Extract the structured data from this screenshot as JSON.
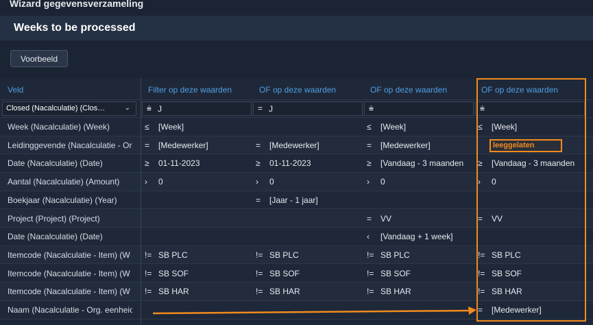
{
  "window": {
    "title": "Wizard gegevensverzameling"
  },
  "header": {
    "title": "Weeks to be processed"
  },
  "toolbar": {
    "preview_label": "Voorbeeld"
  },
  "columns": {
    "field": "Veld",
    "c1": "Filter op deze waarden",
    "c2": "OF op deze waarden",
    "c3": "OF op deze waarden",
    "c4": "OF op deze waarden"
  },
  "filter_row": {
    "field_value": "Closed (Nacalculatie) (Clos…",
    "c1": {
      "op": "=",
      "val": "J"
    },
    "c2": {
      "op": "=",
      "val": "J"
    },
    "c3": {
      "op": "",
      "val": ""
    },
    "c4": {
      "op": "",
      "val": ""
    }
  },
  "rows": [
    {
      "field": "Week (Nacalculatie) (Week)",
      "c1": {
        "op": "≤",
        "val": "[Week]"
      },
      "c2": {
        "op": "",
        "val": ""
      },
      "c3": {
        "op": "≤",
        "val": "[Week]"
      },
      "c4": {
        "op": "≤",
        "val": "[Week]"
      }
    },
    {
      "field": "Leidinggevende (Nacalculatie - Or",
      "c1": {
        "op": "=",
        "val": "[Medewerker]"
      },
      "c2": {
        "op": "=",
        "val": "[Medewerker]"
      },
      "c3": {
        "op": "=",
        "val": "[Medewerker]"
      },
      "c4": {
        "op": "",
        "val": ""
      }
    },
    {
      "field": "Date (Nacalculatie) (Date)",
      "c1": {
        "op": "≥",
        "val": "01-11-2023"
      },
      "c2": {
        "op": "≥",
        "val": "01-11-2023"
      },
      "c3": {
        "op": "≥",
        "val": "[Vandaag - 3 maanden"
      },
      "c4": {
        "op": "≥",
        "val": "[Vandaag - 3 maanden"
      }
    },
    {
      "field": "Aantal (Nacalculatie) (Amount)",
      "c1": {
        "op": "›",
        "val": "0"
      },
      "c2": {
        "op": "›",
        "val": "0"
      },
      "c3": {
        "op": "›",
        "val": "0"
      },
      "c4": {
        "op": "›",
        "val": "0"
      }
    },
    {
      "field": "Boekjaar (Nacalculatie) (Year)",
      "c1": {
        "op": "",
        "val": ""
      },
      "c2": {
        "op": "=",
        "val": "[Jaar - 1 jaar]"
      },
      "c3": {
        "op": "",
        "val": ""
      },
      "c4": {
        "op": "",
        "val": ""
      }
    },
    {
      "field": "Project (Project) (Project)",
      "c1": {
        "op": "",
        "val": ""
      },
      "c2": {
        "op": "",
        "val": ""
      },
      "c3": {
        "op": "=",
        "val": "VV"
      },
      "c4": {
        "op": "=",
        "val": "VV"
      }
    },
    {
      "field": "Date (Nacalculatie) (Date)",
      "c1": {
        "op": "",
        "val": ""
      },
      "c2": {
        "op": "",
        "val": ""
      },
      "c3": {
        "op": "‹",
        "val": "[Vandaag + 1 week]"
      },
      "c4": {
        "op": "",
        "val": ""
      }
    },
    {
      "field": "Itemcode (Nacalculatie - Item) (W",
      "c1": {
        "op": "!=",
        "val": "SB PLC"
      },
      "c2": {
        "op": "!=",
        "val": "SB PLC"
      },
      "c3": {
        "op": "!=",
        "val": "SB PLC"
      },
      "c4": {
        "op": "!=",
        "val": "SB PLC"
      }
    },
    {
      "field": "Itemcode (Nacalculatie - Item) (W",
      "c1": {
        "op": "!=",
        "val": "SB SOF"
      },
      "c2": {
        "op": "!=",
        "val": "SB SOF"
      },
      "c3": {
        "op": "!=",
        "val": "SB SOF"
      },
      "c4": {
        "op": "!=",
        "val": "SB SOF"
      }
    },
    {
      "field": "Itemcode (Nacalculatie - Item) (W",
      "c1": {
        "op": "!=",
        "val": "SB HAR"
      },
      "c2": {
        "op": "!=",
        "val": "SB HAR"
      },
      "c3": {
        "op": "!=",
        "val": "SB HAR"
      },
      "c4": {
        "op": "!=",
        "val": "SB HAR"
      }
    },
    {
      "field": "Naam (Nacalculatie - Org. eenheic",
      "c1": {
        "op": "",
        "val": ""
      },
      "c2": {
        "op": "",
        "val": ""
      },
      "c3": {
        "op": "",
        "val": ""
      },
      "c4": {
        "op": "=",
        "val": "[Medewerker]"
      }
    }
  ],
  "annotation": {
    "note": "leeggelaten",
    "color": "#f28b1e"
  }
}
